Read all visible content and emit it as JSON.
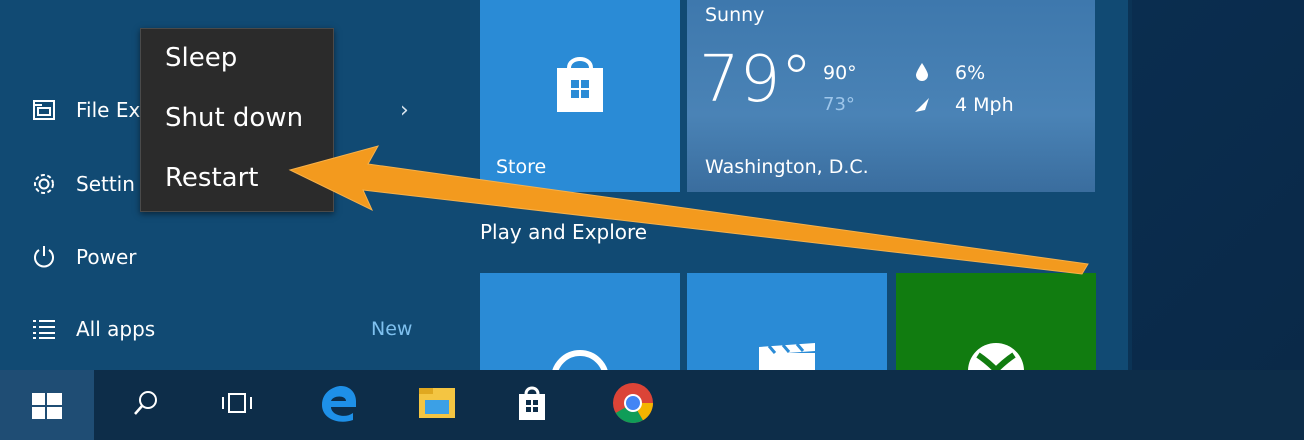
{
  "left_panel": {
    "items": [
      {
        "label": "File Ex",
        "icon": "file-explorer-icon",
        "chevron": "›"
      },
      {
        "label": "Settin",
        "icon": "gear-icon"
      },
      {
        "label": "Power",
        "icon": "power-icon"
      },
      {
        "label": "All apps",
        "icon": "list-icon",
        "badge": "New"
      }
    ]
  },
  "power_menu": {
    "items": [
      "Sleep",
      "Shut down",
      "Restart"
    ]
  },
  "tiles": {
    "store": {
      "label": "Store"
    },
    "weather": {
      "condition": "Sunny",
      "temperature": "79°",
      "high": "90°",
      "low": "73°",
      "humidity": "6%",
      "wind": "4 Mph",
      "city": "Washington, D.C."
    },
    "group_label": "Play and Explore"
  },
  "colors": {
    "accent_arrow": "#f39a1e",
    "tile_blue": "#2a8bd6",
    "tile_green": "#117c10",
    "new_badge": "#7fc1ef"
  },
  "taskbar": {
    "icons": [
      "windows-start-icon",
      "search-icon",
      "task-view-icon",
      "edge-icon",
      "file-explorer-icon",
      "store-icon",
      "chrome-icon"
    ]
  }
}
